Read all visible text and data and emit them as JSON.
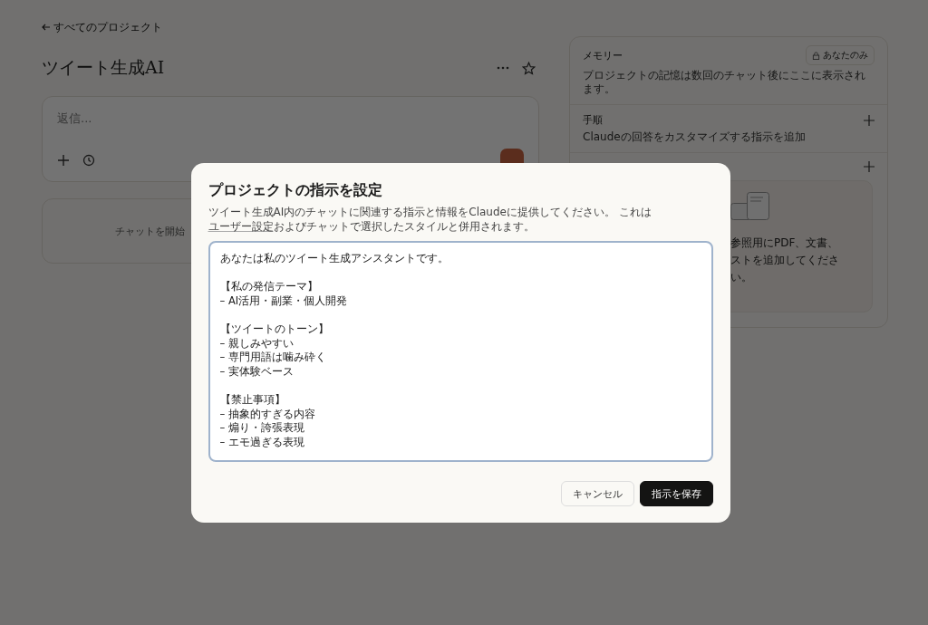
{
  "back_link": "すべてのプロジェクト",
  "project": {
    "title": "ツイート生成AI"
  },
  "composer": {
    "placeholder": "返信..."
  },
  "chats": {
    "empty_text": "チャットを開始"
  },
  "memory": {
    "title": "メモリー",
    "badge": "あなたのみ",
    "description": "プロジェクトの記憶は数回のチャット後にここに表示されます。"
  },
  "procedure": {
    "title": "手順",
    "description": "Claudeの回答をカスタマイズする指示を追加"
  },
  "knowledge": {
    "lines": [
      "参照用にPDF、文書、",
      "ストを追加してくださ",
      "い。"
    ]
  },
  "dialog": {
    "title": "プロジェクトの指示を設定",
    "description_before": "ツイート生成AI内のチャットに関連する指示と情報をClaudeに提供してください。 これは",
    "description_link": "ユーザー設定",
    "description_after": "およびチャットで選択したスタイルと併用されます。",
    "instructions": [
      [
        "あなたは私のツイート生成アシスタントです。"
      ],
      [
        "【私の発信テーマ】",
        "– AI活用・副業・個人開発"
      ],
      [
        "【ツイートのトーン】",
        "– 親しみやすい",
        "– 専門用語は噛み砕く",
        "– 実体験ベース"
      ],
      [
        "【禁止事項】",
        "– 抽象的すぎる内容",
        "– 煽り・誇張表現",
        "– エモ過ぎる表現"
      ]
    ],
    "buttons": [
      {
        "label": "キャンセル",
        "kind": "secondary"
      },
      {
        "label": "指示を保存",
        "kind": "primary"
      }
    ]
  }
}
